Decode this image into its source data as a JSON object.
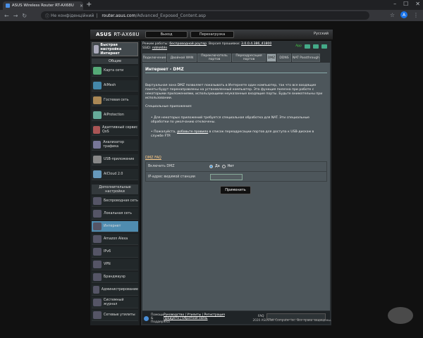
{
  "browser": {
    "tab_title": "ASUS Wireless Router RT-AX68U",
    "new_tab": "+",
    "address_prefix": "Не конфіденційний",
    "address_host": "router.asus.com",
    "address_path": "/Advanced_Exposed_Content.asp",
    "avatar_letter": "A"
  },
  "header": {
    "brand": "ASUS",
    "model": "RT-AX68U",
    "logout": "Выход",
    "reboot": "Перезагрузка",
    "language": "Русский"
  },
  "sidebar": {
    "quick_setup": "Быстрая настройка Интернет",
    "general_title": "Общие",
    "general_items": [
      "Карта сети",
      "AiMesh",
      "Гостевая сеть",
      "AiProtection",
      "Адаптивный сервис QoS",
      "Анализатор трафика",
      "USB-приложение",
      "AiCloud 2.0"
    ],
    "advanced_title": "Дополнительные настройки",
    "advanced_items": [
      "Беспроводная сеть",
      "Локальная сеть",
      "Интернет",
      "Amazon Alexa",
      "IPv6",
      "VPN",
      "Брандмауэр",
      "Администрирование",
      "Системный журнал",
      "Сетевые утилиты"
    ],
    "active_item": "Интернет"
  },
  "status": {
    "mode_label": "Режим работы:",
    "mode_value": "беспроводной роутер",
    "firmware_label": "Версия прошивки:",
    "firmware_value": "3.0.0.4.386_41800",
    "ssid_label": "SSID:",
    "ssid_value": "roblokblo",
    "app_label": "App"
  },
  "tabs": [
    "Подключение",
    "Двойной WAN",
    "Переключатель портов",
    "Переадресация портов",
    "DMZ",
    "DDNS",
    "NAT Passthrough"
  ],
  "active_tab": "DMZ",
  "content": {
    "title": "Интернет - DMZ",
    "intro": "Виртуальная зона DMZ позволяет показывать в Интернете один компьютер, так что все входящие пакеты будут перенаправлены на установленный компьютер. Эта функция полезна при работе с некоторыми приложениями, использующими неуказанные входящие порты. Будьте внимательны при использовании.",
    "special_title": "Специальные приложения:",
    "bullet1": "Для некоторых приложений требуется специальная обработка для NAT. Эти специальные обработки по умолчанию отключены.",
    "bullet2_pre": "Пожалуйста,",
    "bullet2_link": "добавьте правило",
    "bullet2_post": "в список переадресации портов для доступа к USB-дискам в службе FTP.",
    "faq": "DMZ  FAQ",
    "enable_label": "Включить DMZ",
    "yes": "Да",
    "no": "Нет",
    "ip_label": "IP-адрес видимой станции",
    "ip_value": "",
    "apply": "Применить"
  },
  "footer": {
    "help": "Помощь & Поддержка",
    "links_line1": "Руководство | Утилиты | Регистрация",
    "links_line2": "продукта | Обратная связь",
    "faq": "FAQ",
    "copyright": "2020 ASUSTeK Computer Inc. Все права защищены."
  },
  "watermark": "GC"
}
